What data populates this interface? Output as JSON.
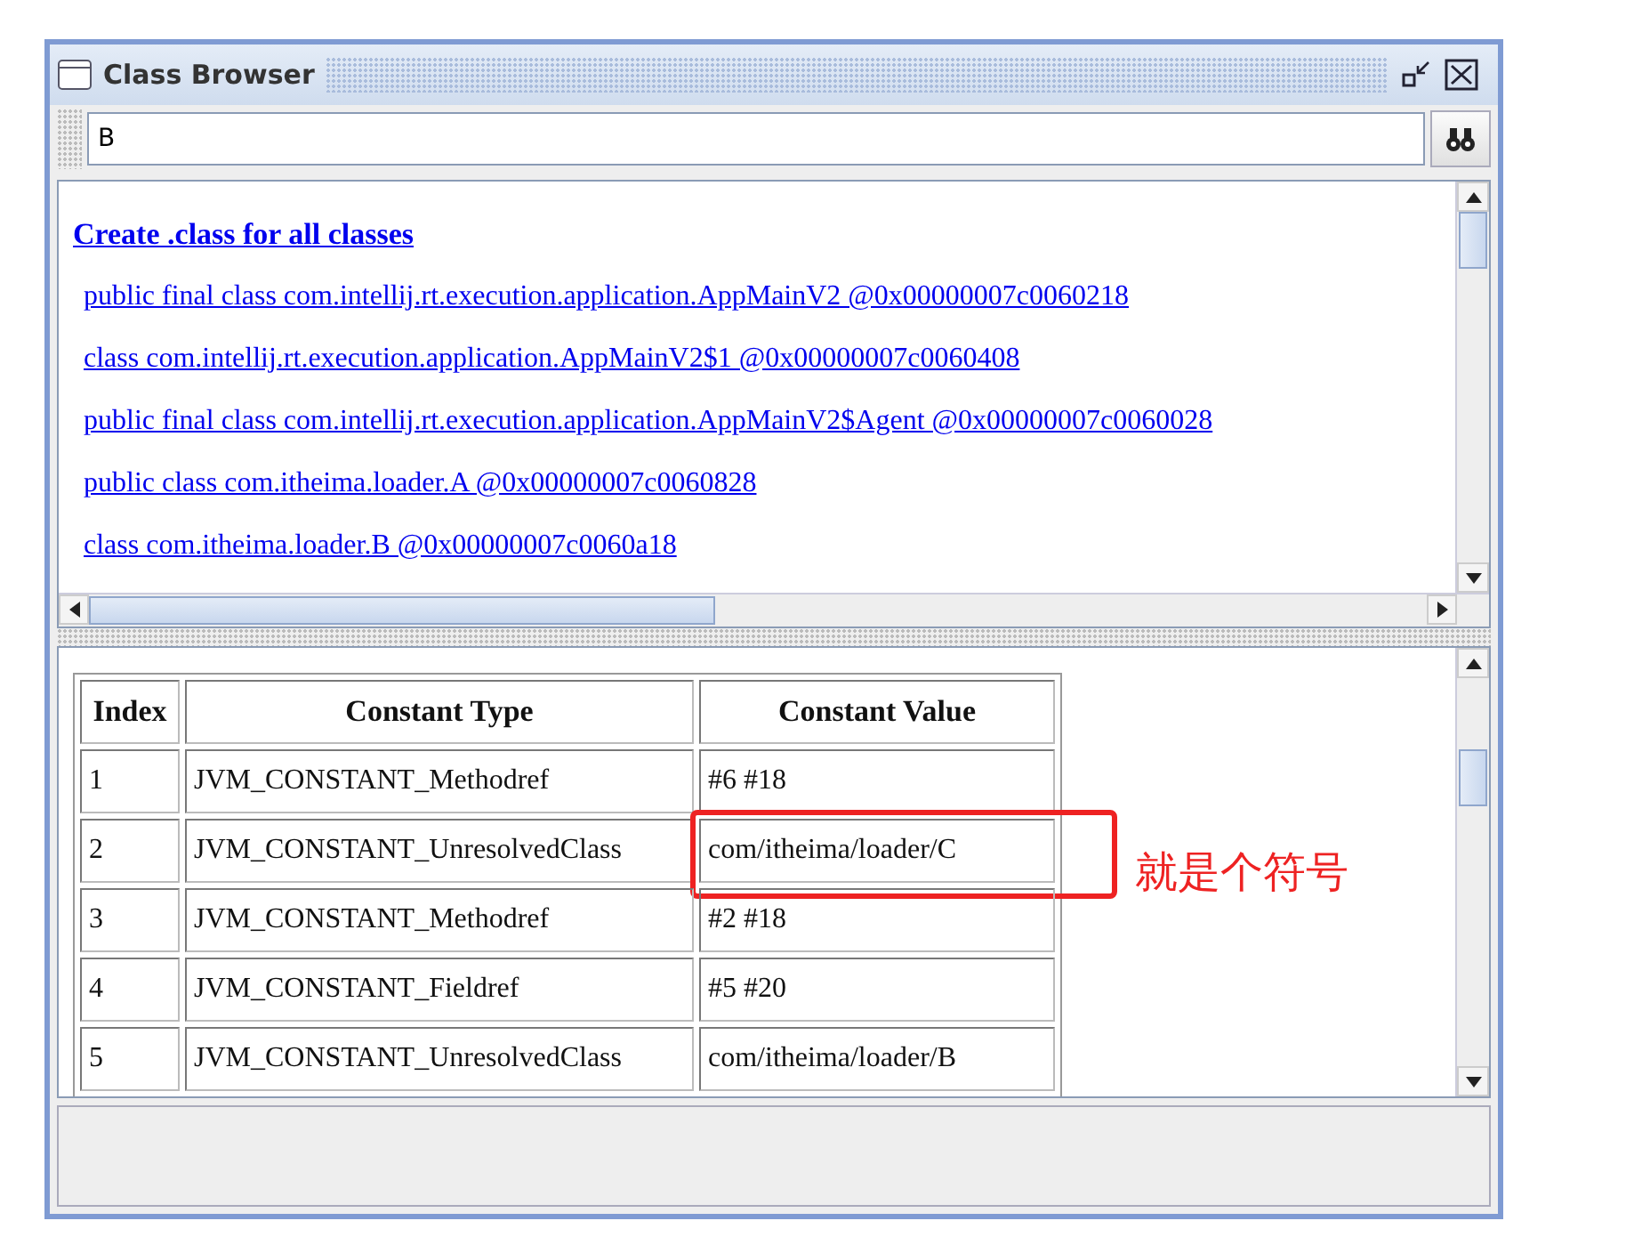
{
  "window": {
    "title": "Class Browser"
  },
  "search": {
    "value": "B"
  },
  "links": {
    "create_all": "Create .class for all classes",
    "classes": [
      "public final class com.intellij.rt.execution.application.AppMainV2 @0x00000007c0060218",
      "class com.intellij.rt.execution.application.AppMainV2$1 @0x00000007c0060408",
      "public final class com.intellij.rt.execution.application.AppMainV2$Agent @0x00000007c0060028",
      "public class com.itheima.loader.A @0x00000007c0060828",
      "class com.itheima.loader.B @0x00000007c0060a18"
    ]
  },
  "table": {
    "columns": [
      "Index",
      "Constant Type",
      "Constant Value"
    ],
    "rows": [
      {
        "cells": [
          "1",
          "JVM_CONSTANT_Methodref",
          "#6 #18"
        ],
        "highlighted": false
      },
      {
        "cells": [
          "2",
          "JVM_CONSTANT_UnresolvedClass",
          "com/itheima/loader/C"
        ],
        "highlighted": true
      },
      {
        "cells": [
          "3",
          "JVM_CONSTANT_Methodref",
          "#2 #18"
        ],
        "highlighted": false
      },
      {
        "cells": [
          "4",
          "JVM_CONSTANT_Fieldref",
          "#5 #20"
        ],
        "highlighted": false
      },
      {
        "cells": [
          "5",
          "JVM_CONSTANT_UnresolvedClass",
          "com/itheima/loader/B"
        ],
        "highlighted": false
      }
    ]
  },
  "annotation": {
    "text": "就是个符号"
  }
}
